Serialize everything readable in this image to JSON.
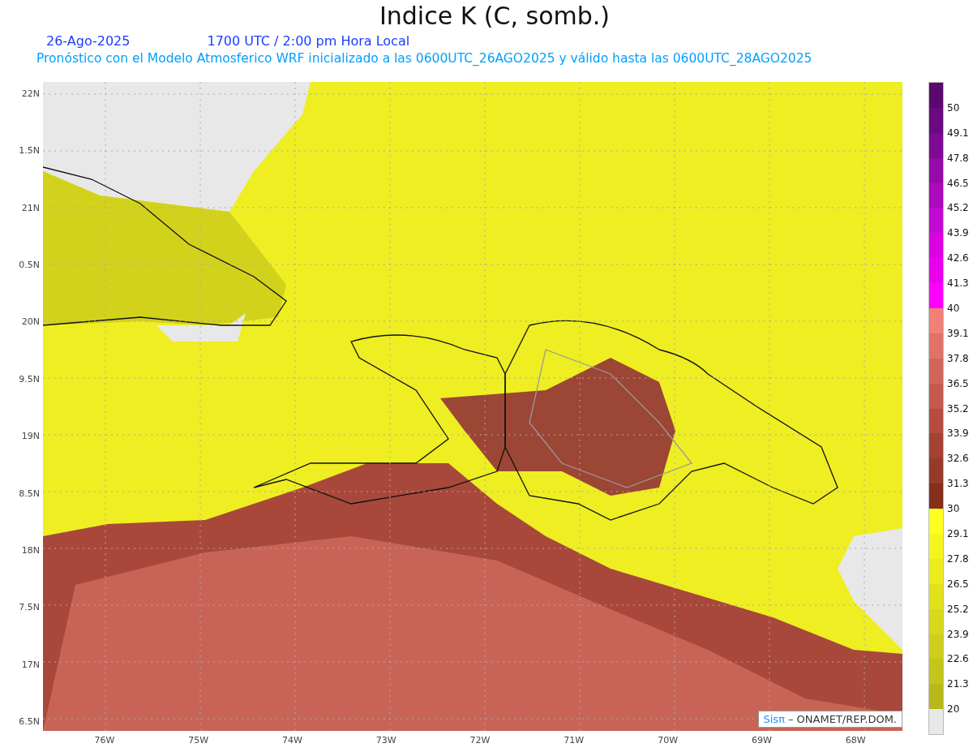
{
  "title": "Indice K (C, somb.)",
  "date": "26-Ago-2025",
  "time": "1700 UTC / 2:00 pm Hora Local",
  "subtitle": "Pronóstico con el Modelo Atmosferico WRF inicializado a las 0600UTC_26AGO2025 y válido hasta las  0600UTC_28AGO2025",
  "y_labels": [
    "22N",
    "1.5N",
    "21N",
    "0.5N",
    "20N",
    "9.5N",
    "19N",
    "8.5N",
    "18N",
    "7.5N",
    "17N",
    "6.5N"
  ],
  "x_labels": [
    "76W",
    "75W",
    "74W",
    "73W",
    "72W",
    "71W",
    "70W",
    "69W",
    "68W"
  ],
  "credit": {
    "brand": "Sisπ",
    "text": "– ONAMET/REP.DOM."
  },
  "colorbar": [
    {
      "color": "#5a0a6e"
    },
    {
      "label": "50",
      "color": "#6a0a80"
    },
    {
      "label": "49.1",
      "color": "#7d0a93"
    },
    {
      "label": "47.8",
      "color": "#960aa8"
    },
    {
      "label": "46.5",
      "color": "#ab0abd"
    },
    {
      "label": "45.2",
      "color": "#c30ad2"
    },
    {
      "label": "43.9",
      "color": "#dc00e3"
    },
    {
      "label": "42.6",
      "color": "#ea00ef"
    },
    {
      "label": "41.3",
      "color": "#ff00ff"
    },
    {
      "label": "40",
      "color": "#f08078"
    },
    {
      "label": "39.1",
      "color": "#e07268"
    },
    {
      "label": "37.8",
      "color": "#d0665a"
    },
    {
      "label": "36.5",
      "color": "#c45a4e"
    },
    {
      "label": "35.2",
      "color": "#b44c40"
    },
    {
      "label": "33.9",
      "color": "#a44234"
    },
    {
      "label": "32.6",
      "color": "#963a2a"
    },
    {
      "label": "31.3",
      "color": "#84301a"
    },
    {
      "label": "30",
      "color": "#ffff20"
    },
    {
      "label": "29.1",
      "color": "#f5f51e"
    },
    {
      "label": "27.8",
      "color": "#ecec1c"
    },
    {
      "label": "26.5",
      "color": "#e2e21c"
    },
    {
      "label": "25.2",
      "color": "#d8d81c"
    },
    {
      "label": "23.9",
      "color": "#cece1c"
    },
    {
      "label": "22.6",
      "color": "#c4c41c"
    },
    {
      "label": "21.3",
      "color": "#b8b818"
    },
    {
      "label": "20",
      "color": "#e8e8e8"
    }
  ]
}
